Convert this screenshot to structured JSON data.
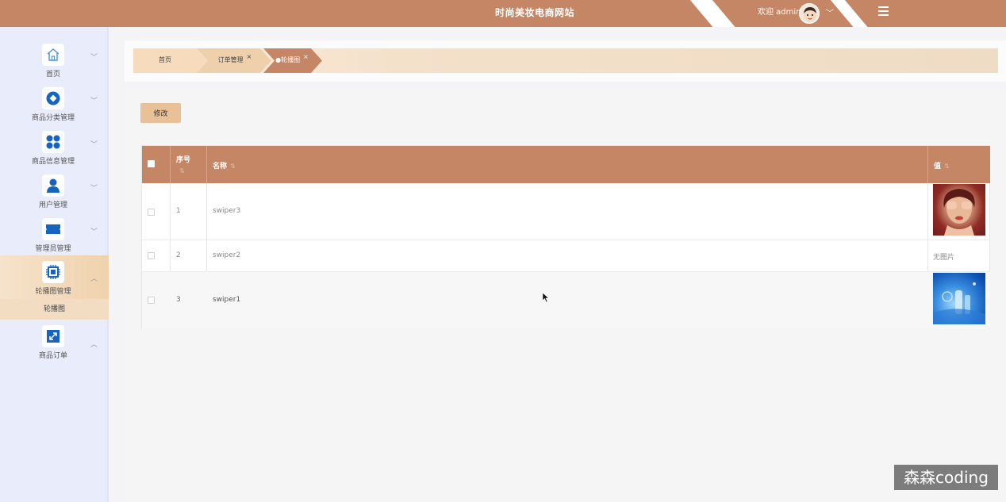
{
  "header": {
    "title": "时尚美妆电商网站",
    "welcome": "欢迎 admin",
    "caret": "﹀",
    "bg_color": "#c58666"
  },
  "sidebar": {
    "items": [
      {
        "label": "首页",
        "icon": "home-icon",
        "arrow": "﹀"
      },
      {
        "label": "商品分类管理",
        "icon": "category-icon",
        "arrow": "﹀"
      },
      {
        "label": "商品信息管理",
        "icon": "grid-icon",
        "arrow": "﹀"
      },
      {
        "label": "用户管理",
        "icon": "user-icon",
        "arrow": "﹀"
      },
      {
        "label": "管理员管理",
        "icon": "admin-icon",
        "arrow": "﹀"
      },
      {
        "label": "轮播图管理",
        "icon": "chip-icon",
        "arrow": "︿"
      },
      {
        "label": "商品订单",
        "icon": "order-icon",
        "arrow": "︿"
      }
    ],
    "sub_item": "轮播图",
    "active_color": "#f0d2ad"
  },
  "breadcrumb": {
    "tabs": [
      {
        "label": "首页",
        "closable": false
      },
      {
        "label": "订单管理",
        "closable": true
      },
      {
        "label": "●轮播图",
        "closable": true
      }
    ],
    "close_glyph": "×"
  },
  "toolbar": {
    "edit_label": "修改"
  },
  "table": {
    "columns": [
      "序号",
      "名称",
      "值"
    ],
    "sort_glyph": "⇅",
    "rows": [
      {
        "index": "1",
        "name": "swiper3",
        "value_type": "image"
      },
      {
        "index": "2",
        "name": "swiper2",
        "value_type": "text",
        "value": "无图片"
      },
      {
        "index": "3",
        "name": "swiper1",
        "value_type": "image"
      }
    ]
  },
  "watermark": "森森coding"
}
